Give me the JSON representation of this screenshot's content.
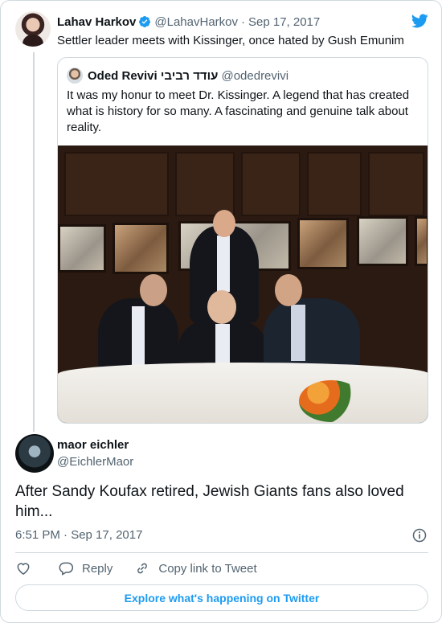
{
  "tweet": {
    "author_name": "Lahav Harkov",
    "handle": "@LahavHarkov",
    "separator": "·",
    "date": "Sep 17, 2017",
    "text": "Settler leader meets with Kissinger, once hated by Gush Emunim",
    "verified_icon": "verified-badge-icon",
    "brand_icon": "twitter-bird-icon",
    "brand_color": "#1d9bf0"
  },
  "quoted": {
    "author_name": "Oded Revivi עודד רביבי",
    "handle": "@odedrevivi",
    "text": "It was my honur to meet Dr.  Kissinger. A legend that has created what is history for so many. A fascinating and genuine talk about reality."
  },
  "reply": {
    "author_name": "maor eichler",
    "handle": "@EichlerMaor",
    "text": "After Sandy Koufax retired, Jewish Giants fans also loved him...",
    "timestamp": "6:51 PM · Sep 17, 2017",
    "info_icon": "info-icon"
  },
  "actions": {
    "like_icon": "heart-icon",
    "reply_label": "Reply",
    "copy_label": "Copy link to Tweet"
  },
  "footer": {
    "explore_label": "Explore what's happening on Twitter"
  },
  "colors": {
    "text": "#0f1419",
    "secondary": "#536471",
    "border": "#cfd9de",
    "link": "#1d9bf0"
  }
}
